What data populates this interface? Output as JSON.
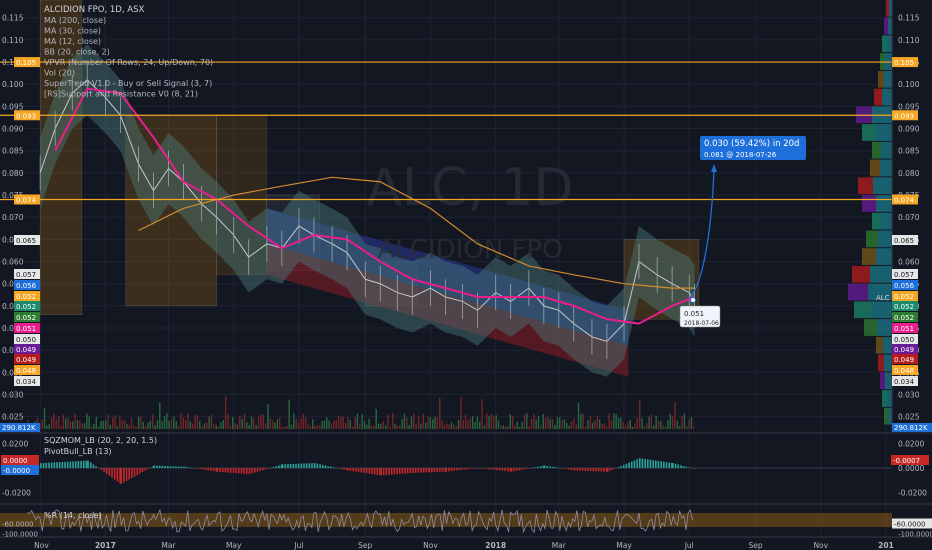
{
  "symbol_title": "ALCIDION FPO, 1D, ASX",
  "watermark": {
    "ticker": "ALC, 1D",
    "name": "ALCIDION FPO"
  },
  "indicators": [
    "MA (200, close)",
    "MA (30, close)",
    "MA (12, close)",
    "BB (20, close, 2)",
    "VPVR (Number Of Rows, 24, Up/Down, 70)",
    "Vol (20)",
    "SuperTrend V1.0 - Buy or Sell Signal (3, 7)",
    "[RS]Support and Resistance V0 (8, 21)"
  ],
  "projection": {
    "change": "0.030 (59.42%)  in 20d",
    "target": "0.081 @ 2018-07-26"
  },
  "point_label": {
    "value": "0.051",
    "date": "2018-07-06"
  },
  "right_axis_label": "ALC",
  "colors": {
    "background": "#131722",
    "resistance_lines": "#f5a623",
    "ma_fast": "#e91e8c",
    "ma_slow": "#d38b2c",
    "bb_fill": "#4a7a7a",
    "channel_blue": "#2a3a9a",
    "channel_red": "#8a1c24",
    "callout_blue": "#1e6fd9"
  },
  "chart_data": [
    {
      "type": "line",
      "title": "ALCIDION FPO, 1D, ASX",
      "x_ticks": [
        "Nov",
        "2017",
        "Mar",
        "May",
        "Jul",
        "Sep",
        "Nov",
        "2018",
        "Mar",
        "May",
        "Jul",
        "Sep",
        "Nov",
        "201"
      ],
      "y_ticks": [
        0.025,
        0.03,
        0.035,
        0.04,
        0.045,
        0.05,
        0.055,
        0.06,
        0.065,
        0.07,
        0.075,
        0.08,
        0.085,
        0.09,
        0.095,
        0.1,
        0.105,
        0.11,
        0.115
      ],
      "ylim": [
        0.022,
        0.119
      ],
      "series": [
        {
          "color": "#c8c8c8",
          "x": [
            "2016-11-01",
            "2016-11-15",
            "2016-12-01",
            "2016-12-15",
            "2017-01-01",
            "2017-01-15",
            "2017-02-01",
            "2017-02-15",
            "2017-03-01",
            "2017-03-15",
            "2017-04-01",
            "2017-04-15",
            "2017-05-01",
            "2017-05-15",
            "2017-06-01",
            "2017-06-15",
            "2017-07-01",
            "2017-07-15",
            "2017-08-01",
            "2017-08-15",
            "2017-09-01",
            "2017-09-15",
            "2017-10-01",
            "2017-10-15",
            "2017-11-01",
            "2017-11-15",
            "2017-12-01",
            "2017-12-15",
            "2018-01-01",
            "2018-01-15",
            "2018-02-01",
            "2018-02-15",
            "2018-03-01",
            "2018-03-15",
            "2018-04-01",
            "2018-04-15",
            "2018-05-01",
            "2018-05-15",
            "2018-06-01",
            "2018-06-15",
            "2018-07-01",
            "2018-07-06"
          ],
          "values": [
            0.08,
            0.09,
            0.098,
            0.101,
            0.097,
            0.093,
            0.082,
            0.076,
            0.081,
            0.078,
            0.073,
            0.07,
            0.066,
            0.061,
            0.064,
            0.063,
            0.068,
            0.066,
            0.064,
            0.062,
            0.056,
            0.055,
            0.053,
            0.052,
            0.054,
            0.052,
            0.051,
            0.049,
            0.053,
            0.051,
            0.054,
            0.05,
            0.049,
            0.046,
            0.043,
            0.042,
            0.046,
            0.06,
            0.057,
            0.055,
            0.053,
            0.051
          ]
        },
        {
          "name": "MA (30, close)",
          "color": "#e91e8c",
          "x": [
            "2016-11-15",
            "2016-12-15",
            "2017-01-15",
            "2017-02-15",
            "2017-03-15",
            "2017-04-15",
            "2017-05-15",
            "2017-06-15",
            "2017-07-15",
            "2017-08-15",
            "2017-09-15",
            "2017-10-15",
            "2017-11-15",
            "2017-12-15",
            "2018-01-15",
            "2018-02-15",
            "2018-03-15",
            "2018-04-15",
            "2018-05-15",
            "2018-06-15",
            "2018-07-06"
          ],
          "values": [
            0.085,
            0.099,
            0.098,
            0.088,
            0.078,
            0.074,
            0.068,
            0.063,
            0.066,
            0.065,
            0.06,
            0.056,
            0.054,
            0.052,
            0.052,
            0.052,
            0.05,
            0.047,
            0.046,
            0.05,
            0.052
          ]
        },
        {
          "name": "MA (200, close)",
          "color": "#d38b2c",
          "x": [
            "2017-02-01",
            "2017-03-15",
            "2017-05-01",
            "2017-06-15",
            "2017-08-01",
            "2017-09-15",
            "2017-11-01",
            "2017-12-15",
            "2018-02-01",
            "2018-03-15",
            "2018-05-01",
            "2018-06-15",
            "2018-07-06"
          ],
          "values": [
            0.067,
            0.072,
            0.075,
            0.077,
            0.079,
            0.078,
            0.072,
            0.064,
            0.059,
            0.057,
            0.055,
            0.054,
            0.054
          ]
        }
      ],
      "horizontal_levels": [
        0.105,
        0.093,
        0.074
      ],
      "price_labels": [
        "0.065",
        "0.057",
        "0.056",
        "0.052",
        "0.052",
        "0.052",
        "0.051",
        "0.050",
        "0.049",
        "0.049",
        "0.048",
        "0.034",
        "0.105",
        "0.093",
        "0.074"
      ],
      "volume_label": "290.812K"
    },
    {
      "type": "area",
      "title": "SQZMOM_LB (20, 2, 20, 1.5)",
      "subtitle": "PivotBull_LB (13)",
      "y_ticks": [
        0.02,
        0.0,
        -0.02
      ],
      "ylim": [
        -0.026,
        0.026
      ],
      "last_values": [
        "0.0000",
        "-0.0000",
        "-0.0007"
      ],
      "x": [
        "2016-11-01",
        "2016-12-15",
        "2017-01-15",
        "2017-02-15",
        "2017-03-15",
        "2017-04-15",
        "2017-05-15",
        "2017-06-15",
        "2017-07-15",
        "2017-08-15",
        "2017-09-15",
        "2017-10-15",
        "2017-11-15",
        "2017-12-15",
        "2018-01-15",
        "2018-02-15",
        "2018-03-15",
        "2018-04-15",
        "2018-05-15",
        "2018-06-15",
        "2018-07-06"
      ],
      "values": [
        0.004,
        0.006,
        -0.013,
        0.002,
        0.001,
        -0.003,
        -0.005,
        0.003,
        0.004,
        -0.002,
        -0.006,
        -0.004,
        -0.003,
        0.0,
        -0.003,
        0.002,
        -0.002,
        -0.003,
        0.008,
        0.004,
        -0.001
      ]
    },
    {
      "type": "line",
      "title": "%R (14, close)",
      "y_ticks": [
        -60.0,
        -100.0
      ],
      "y_tick_labels": [
        "-60.0000",
        "-100.0000"
      ],
      "last_value": "-60.0000",
      "ylim": [
        -110,
        10
      ]
    }
  ]
}
